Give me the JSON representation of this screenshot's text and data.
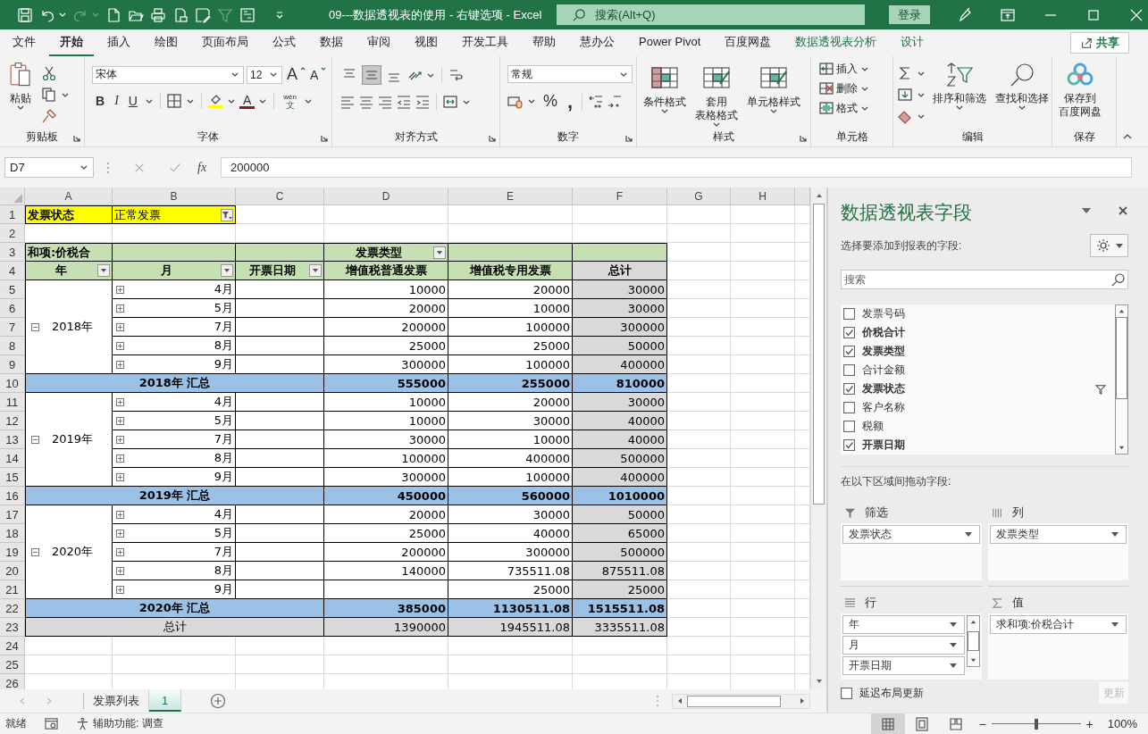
{
  "title_bar": {
    "title": "09---数据透视表的使用 - 右键选项  -  Excel",
    "search_placeholder": "搜索(Alt+Q)",
    "sign_in": "登录"
  },
  "tabs": [
    {
      "label": "文件",
      "selected": false,
      "kind": "main"
    },
    {
      "label": "开始",
      "selected": true,
      "kind": "main"
    },
    {
      "label": "插入",
      "selected": false,
      "kind": "main"
    },
    {
      "label": "绘图",
      "selected": false,
      "kind": "main"
    },
    {
      "label": "页面布局",
      "selected": false,
      "kind": "main"
    },
    {
      "label": "公式",
      "selected": false,
      "kind": "main"
    },
    {
      "label": "数据",
      "selected": false,
      "kind": "main"
    },
    {
      "label": "审阅",
      "selected": false,
      "kind": "main"
    },
    {
      "label": "视图",
      "selected": false,
      "kind": "main"
    },
    {
      "label": "开发工具",
      "selected": false,
      "kind": "main"
    },
    {
      "label": "帮助",
      "selected": false,
      "kind": "main"
    },
    {
      "label": "慧办公",
      "selected": false,
      "kind": "main"
    },
    {
      "label": "Power Pivot",
      "selected": false,
      "kind": "main"
    },
    {
      "label": "百度网盘",
      "selected": false,
      "kind": "main"
    },
    {
      "label": "数据透视表分析",
      "selected": false,
      "kind": "context"
    },
    {
      "label": "设计",
      "selected": false,
      "kind": "context"
    }
  ],
  "share": "共享",
  "ribbon": {
    "clipboard": {
      "label": "剪贴板",
      "paste": "粘贴"
    },
    "font": {
      "label": "字体",
      "name": "宋体",
      "size": "12",
      "grow": "A",
      "shrink": "A",
      "bold": "B",
      "italic": "I",
      "underline": "U",
      "font_color_letter": "A",
      "phonetic": "wén",
      "phonetic_char": "文"
    },
    "alignment": {
      "label": "对齐方式",
      "vertical": [
        {
          "selected": false
        },
        {
          "selected": true
        },
        {
          "selected": false
        }
      ]
    },
    "number": {
      "label": "数字",
      "format": "常规",
      "percent": "%",
      "comma": ","
    },
    "styles": {
      "label": "样式",
      "buttons": [
        [
          "条件格式"
        ],
        [
          "套用",
          "表格格式"
        ],
        [
          "单元格样式"
        ]
      ]
    },
    "cells": {
      "label": "单元格",
      "buttons": [
        "插入",
        "删除",
        "格式"
      ]
    },
    "editing": {
      "label": "编辑",
      "buttons": [
        "排序和筛选",
        "查找和选择"
      ]
    },
    "save": {
      "label": "保存",
      "button": [
        "保存到",
        "百度网盘"
      ]
    }
  },
  "formula_bar": {
    "name_box": "D7",
    "fx": "fx",
    "value": "200000"
  },
  "sheet": {
    "columns": [
      "A",
      "B",
      "C",
      "D",
      "E",
      "F",
      "G",
      "H"
    ],
    "rows": [
      "1",
      "2",
      "3",
      "4",
      "5",
      "6",
      "7",
      "8",
      "9",
      "10",
      "11",
      "12",
      "13",
      "14",
      "15",
      "16",
      "17",
      "18",
      "19",
      "20",
      "21",
      "22",
      "23",
      "24",
      "25",
      "26"
    ]
  },
  "pivot": {
    "filter": {
      "label": "发票状态",
      "value": "正常发票",
      "filtered": true
    },
    "value_label": "和项:价税合",
    "column_field": {
      "text": "发票类型",
      "dropdown": true
    },
    "headers": [
      {
        "text": "年",
        "dropdown": true
      },
      {
        "text": "月",
        "dropdown": true
      },
      {
        "text": "开票日期",
        "dropdown": true
      },
      {
        "text": "增值税普通发票",
        "dropdown": false
      },
      {
        "text": "增值税专用发票",
        "dropdown": false
      },
      {
        "text": "总计",
        "dropdown": false
      }
    ],
    "years": [
      {
        "year": "2018年",
        "expanded": true,
        "months": [
          {
            "month": "4月",
            "expanded": false,
            "general": "10000",
            "special": "20000",
            "total": "30000"
          },
          {
            "month": "5月",
            "expanded": false,
            "general": "20000",
            "special": "10000",
            "total": "30000"
          },
          {
            "month": "7月",
            "expanded": false,
            "general": "200000",
            "special": "100000",
            "total": "300000"
          },
          {
            "month": "8月",
            "expanded": false,
            "general": "25000",
            "special": "25000",
            "total": "50000"
          },
          {
            "month": "9月",
            "expanded": false,
            "general": "300000",
            "special": "100000",
            "total": "400000"
          }
        ],
        "subtotal": {
          "label": "2018年 汇总",
          "values": [
            "555000",
            "255000",
            "810000"
          ]
        }
      },
      {
        "year": "2019年",
        "expanded": true,
        "months": [
          {
            "month": "4月",
            "expanded": false,
            "general": "10000",
            "special": "20000",
            "total": "30000"
          },
          {
            "month": "5月",
            "expanded": false,
            "general": "10000",
            "special": "30000",
            "total": "40000"
          },
          {
            "month": "7月",
            "expanded": false,
            "general": "30000",
            "special": "10000",
            "total": "40000"
          },
          {
            "month": "8月",
            "expanded": false,
            "general": "100000",
            "special": "400000",
            "total": "500000"
          },
          {
            "month": "9月",
            "expanded": false,
            "general": "300000",
            "special": "100000",
            "total": "400000"
          }
        ],
        "subtotal": {
          "label": "2019年 汇总",
          "values": [
            "450000",
            "560000",
            "1010000"
          ]
        }
      },
      {
        "year": "2020年",
        "expanded": true,
        "months": [
          {
            "month": "4月",
            "expanded": false,
            "general": "20000",
            "special": "30000",
            "total": "50000"
          },
          {
            "month": "5月",
            "expanded": false,
            "general": "25000",
            "special": "40000",
            "total": "65000"
          },
          {
            "month": "7月",
            "expanded": false,
            "general": "200000",
            "special": "300000",
            "total": "500000"
          },
          {
            "month": "8月",
            "expanded": false,
            "general": "140000",
            "special": "735511.08",
            "total": "875511.08"
          },
          {
            "month": "9月",
            "expanded": false,
            "special": "25000",
            "total": "25000"
          }
        ],
        "subtotal": {
          "label": "2020年 汇总",
          "values": [
            "385000",
            "1130511.08",
            "1515511.08"
          ]
        }
      }
    ],
    "grand_total": {
      "label": "总计",
      "values": [
        "1390000",
        "1945511.08",
        "3335511.08"
      ]
    }
  },
  "sheet_tabs": [
    {
      "label": "发票列表",
      "selected": false
    },
    {
      "label": "1",
      "selected": true
    }
  ],
  "pivot_fields": {
    "title": "数据透视表字段",
    "subtitle": "选择要添加到报表的字段:",
    "search_placeholder": "搜索",
    "fields": [
      {
        "name": "发票号码",
        "checked": false,
        "filtered": false
      },
      {
        "name": "价税合计",
        "checked": true,
        "filtered": false
      },
      {
        "name": "发票类型",
        "checked": true,
        "filtered": false
      },
      {
        "name": "合计金额",
        "checked": false,
        "filtered": false
      },
      {
        "name": "发票状态",
        "checked": true,
        "filtered": true
      },
      {
        "name": "客户名称",
        "checked": false,
        "filtered": false
      },
      {
        "name": "税额",
        "checked": false,
        "filtered": false
      },
      {
        "name": "开票日期",
        "checked": true,
        "filtered": false
      }
    ],
    "areas_label": "在以下区域间拖动字段:",
    "areas": [
      {
        "kind": "filters",
        "label": "筛选",
        "items": [
          "发票状态"
        ]
      },
      {
        "kind": "columns",
        "label": "列",
        "items": [
          "发票类型"
        ]
      },
      {
        "kind": "rows",
        "label": "行",
        "items": [
          "年",
          "月",
          "开票日期"
        ]
      },
      {
        "kind": "values",
        "label": "值",
        "items": [
          "求和项:价税合计"
        ]
      }
    ],
    "defer": {
      "label": "延迟布局更新",
      "checked": false
    },
    "update": {
      "label": "更新",
      "disabled": true
    }
  },
  "status_bar": {
    "ready": "就绪",
    "accessibility": "辅助功能: 调查",
    "views": [
      {
        "selected": true
      },
      {
        "selected": false
      },
      {
        "selected": false
      }
    ],
    "zoom_minus": "−",
    "zoom_plus": "+",
    "zoom": {
      "level": 0.5
    },
    "zoom_text": "100%"
  }
}
